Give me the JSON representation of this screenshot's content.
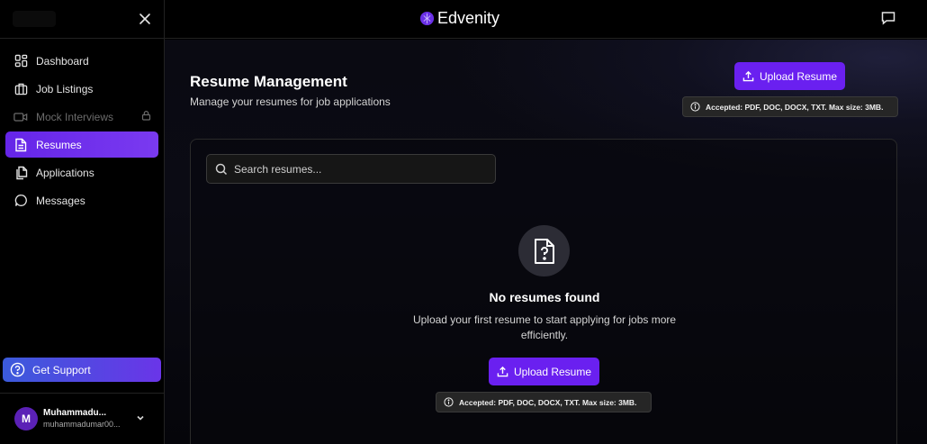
{
  "app": {
    "name": "Edvenity"
  },
  "sidebar": {
    "items": [
      {
        "label": "Dashboard",
        "icon": "dashboard-icon"
      },
      {
        "label": "Job Listings",
        "icon": "briefcase-icon"
      },
      {
        "label": "Mock Interviews",
        "icon": "video-icon",
        "locked": true
      },
      {
        "label": "Resumes",
        "icon": "document-icon",
        "active": true
      },
      {
        "label": "Applications",
        "icon": "copy-icon"
      },
      {
        "label": "Messages",
        "icon": "chat-icon"
      }
    ],
    "support_label": "Get Support",
    "user": {
      "initial": "M",
      "name": "Muhammadu...",
      "email": "muhammadumar00..."
    }
  },
  "main": {
    "title": "Resume Management",
    "subtitle": "Manage your resumes for job applications",
    "upload_label": "Upload Resume",
    "accepted_note": "Accepted: PDF, DOC, DOCX, TXT. Max size: 3MB.",
    "search_placeholder": "Search resumes...",
    "empty": {
      "title": "No resumes found",
      "description": "Upload your first resume to start applying for jobs more efficiently."
    }
  },
  "colors": {
    "accent": "#6a20f0",
    "support_gradient_start": "#3b5bdb",
    "background": "#000000"
  }
}
